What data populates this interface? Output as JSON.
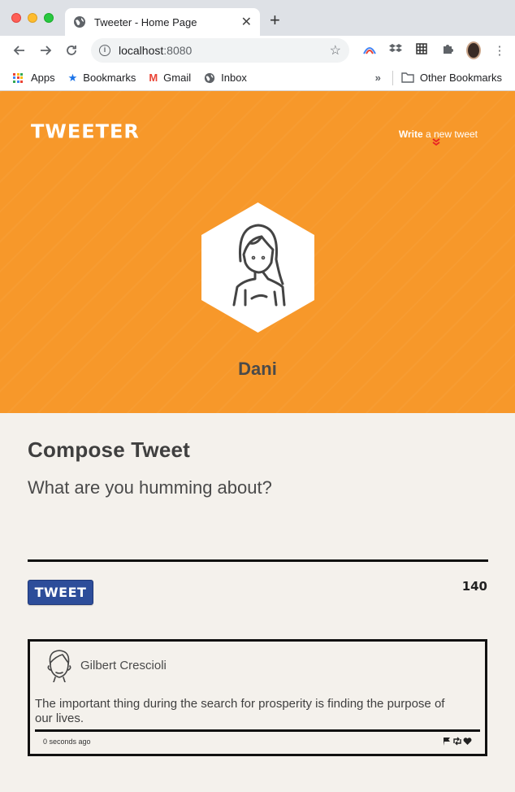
{
  "browser": {
    "tab_title": "Tweeter - Home Page",
    "url_host": "localhost",
    "url_port": ":8080",
    "new_tab_label": "+",
    "close_tab_label": "✕"
  },
  "bookmarks": {
    "items": [
      {
        "label": "Apps"
      },
      {
        "label": "Bookmarks"
      },
      {
        "label": "Gmail"
      },
      {
        "label": "Inbox"
      }
    ],
    "overflow_label": "»",
    "other_label": "Other Bookmarks"
  },
  "header": {
    "logo": "TWEETER",
    "write_bold": "Write",
    "write_rest": " a new tweet",
    "write_arrow": "»"
  },
  "profile": {
    "name": "Dani"
  },
  "compose": {
    "title": "Compose Tweet",
    "placeholder": "What are you humming about?",
    "button_label": "TWEET",
    "counter": "140"
  },
  "tweets": [
    {
      "author": "Gilbert Crescioli",
      "content": "The important thing during the search for prosperity is finding the purpose of our lives.",
      "time": "0 seconds ago",
      "actions": [
        "flag-icon",
        "retweet-icon",
        "heart-icon"
      ]
    }
  ],
  "colors": {
    "hero": "#f7982a",
    "page_bg": "#f4f1ec",
    "tweet_button": "#2d4d9a",
    "accent_arrow": "#e82325"
  }
}
